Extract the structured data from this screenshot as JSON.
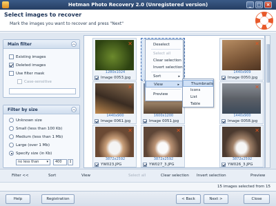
{
  "window": {
    "title": "Hetman Photo Recovery 2.0 (Unregistered version)",
    "controls": [
      "_",
      "□",
      "×"
    ]
  },
  "header": {
    "title": "Select images to recover",
    "subtitle": "Mark the images you want to recover and press \"Next\""
  },
  "main_filter": {
    "title": "Main filter",
    "existing": "Existing images",
    "deleted": "Deleted images",
    "use_mask": "Use filter mask",
    "case_sensitive": "Case-sensitive"
  },
  "size_filter": {
    "title": "Filter by size",
    "unknown": "Unknown size",
    "small": "Small (less than 100 Kb)",
    "medium": "Medium (less than 1 Mb)",
    "large": "Large (over 1 Mb)",
    "specify": "Specify size (in Kb)",
    "op": "no less than",
    "value": "400"
  },
  "images": [
    {
      "dim": "1280x1024",
      "name": "Image 0053.jpg"
    },
    {
      "dim": "",
      "name": ""
    },
    {
      "dim": "1440x909",
      "name": "Image 0050.jpg"
    },
    {
      "dim": "1440x900",
      "name": "Image 0061.jpg"
    },
    {
      "dim": "1600x1200",
      "name": "Image 0051.jpg"
    },
    {
      "dim": "1440x900",
      "name": "Image 0058.jpg"
    },
    {
      "dim": "3872x2592",
      "name": "YW023.JPG"
    },
    {
      "dim": "3872x2592",
      "name": "YW027_3.JPG"
    },
    {
      "dim": "3872x2592",
      "name": "YW026_3.JPG"
    }
  ],
  "context_menu": {
    "deselect": "Deselect",
    "select_all": "Select all",
    "clear_selection": "Clear selection",
    "invert_selection": "Invert selection",
    "sort": "Sort",
    "view": "View",
    "preview": "Preview"
  },
  "view_submenu": {
    "thumbnails": "Thumbnails",
    "icons": "Icons",
    "list": "List",
    "table": "Table"
  },
  "toolbar": {
    "filter": "Filter <<",
    "sort": "Sort",
    "view": "View",
    "select_all": "Select all",
    "clear_selection": "Clear selection",
    "invert_selection": "Invert selection",
    "preview": "Preview"
  },
  "status": "15 images selected from 15",
  "buttons": {
    "help": "Help",
    "registration": "Registration",
    "back": "< Back",
    "next": "Next >",
    "close": "Close"
  },
  "colors": {
    "accent": "#3d6bb3",
    "delete_mark": "#e2541f",
    "title_bar": "#253e63"
  }
}
